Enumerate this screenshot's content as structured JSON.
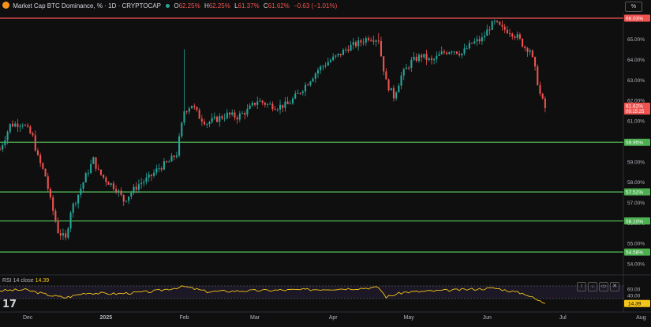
{
  "header": {
    "title": "Market Cap BTC Dominance, % · 1D · CRYPTOCAP",
    "o_label": "O",
    "o_value": "62.25%",
    "h_label": "H",
    "h_value": "62.25%",
    "l_label": "L",
    "l_value": "61.37%",
    "c_label": "C",
    "c_value": "61.62%",
    "change": "−0.63 (−1.01%)",
    "scale_button": "%"
  },
  "colors": {
    "up": "#26a69a",
    "down": "#ef5350",
    "support": "#4caf50",
    "resistance": "#ef5350",
    "rsi": "#f5c518",
    "background": "#0f0f0f"
  },
  "chart_data": {
    "type": "candlestick",
    "title": "Market Cap BTC Dominance, %",
    "ylim": [
      53.5,
      66.3
    ],
    "y_ticks": [
      "65.00%",
      "64.00%",
      "63.00%",
      "62.00%",
      "61.00%",
      "60.00%",
      "59.00%",
      "58.00%",
      "57.00%",
      "56.00%",
      "55.00%",
      "54.00%"
    ],
    "x_ticks": [
      "Dec",
      "2025",
      "Feb",
      "Mar",
      "Apr",
      "May",
      "Jun",
      "Jul",
      "Aug"
    ],
    "close_path": [
      {
        "day": 0,
        "v": 59.6
      },
      {
        "day": 4,
        "v": 60.8
      },
      {
        "day": 9,
        "v": 60.9
      },
      {
        "day": 13,
        "v": 60.2
      },
      {
        "day": 15,
        "v": 59.2
      },
      {
        "day": 18,
        "v": 58.3
      },
      {
        "day": 20,
        "v": 57.1
      },
      {
        "day": 23,
        "v": 55.6
      },
      {
        "day": 26,
        "v": 55.2
      },
      {
        "day": 28,
        "v": 56.6
      },
      {
        "day": 31,
        "v": 57.4
      },
      {
        "day": 34,
        "v": 58.3
      },
      {
        "day": 37,
        "v": 59.1
      },
      {
        "day": 39,
        "v": 58.5
      },
      {
        "day": 42,
        "v": 58.1
      },
      {
        "day": 46,
        "v": 57.7
      },
      {
        "day": 49,
        "v": 57.1
      },
      {
        "day": 52,
        "v": 57.5
      },
      {
        "day": 55,
        "v": 57.9
      },
      {
        "day": 59,
        "v": 58.2
      },
      {
        "day": 63,
        "v": 58.7
      },
      {
        "day": 67,
        "v": 59.0
      },
      {
        "day": 70,
        "v": 59.4
      },
      {
        "day": 73,
        "v": 61.5
      },
      {
        "day": 76,
        "v": 61.8
      },
      {
        "day": 79,
        "v": 61.2
      },
      {
        "day": 82,
        "v": 60.9
      },
      {
        "day": 86,
        "v": 61.1
      },
      {
        "day": 90,
        "v": 61.3
      },
      {
        "day": 94,
        "v": 61.2
      },
      {
        "day": 98,
        "v": 61.5
      },
      {
        "day": 102,
        "v": 62.0
      },
      {
        "day": 106,
        "v": 61.8
      },
      {
        "day": 110,
        "v": 61.7
      },
      {
        "day": 114,
        "v": 61.8
      },
      {
        "day": 118,
        "v": 62.3
      },
      {
        "day": 122,
        "v": 62.9
      },
      {
        "day": 126,
        "v": 63.5
      },
      {
        "day": 130,
        "v": 63.9
      },
      {
        "day": 134,
        "v": 64.2
      },
      {
        "day": 138,
        "v": 64.6
      },
      {
        "day": 142,
        "v": 64.8
      },
      {
        "day": 146,
        "v": 65.1
      },
      {
        "day": 150,
        "v": 65.0
      },
      {
        "day": 151,
        "v": 64.2
      },
      {
        "day": 153,
        "v": 62.9
      },
      {
        "day": 156,
        "v": 62.2
      },
      {
        "day": 159,
        "v": 63.2
      },
      {
        "day": 163,
        "v": 63.9
      },
      {
        "day": 167,
        "v": 64.2
      },
      {
        "day": 171,
        "v": 63.9
      },
      {
        "day": 175,
        "v": 64.3
      },
      {
        "day": 179,
        "v": 64.5
      },
      {
        "day": 183,
        "v": 64.3
      },
      {
        "day": 187,
        "v": 64.8
      },
      {
        "day": 191,
        "v": 65.0
      },
      {
        "day": 194,
        "v": 65.6
      },
      {
        "day": 196,
        "v": 65.8
      },
      {
        "day": 199,
        "v": 65.5
      },
      {
        "day": 202,
        "v": 65.4
      },
      {
        "day": 205,
        "v": 65.1
      },
      {
        "day": 208,
        "v": 64.6
      },
      {
        "day": 210,
        "v": 64.5
      },
      {
        "day": 212,
        "v": 63.5
      },
      {
        "day": 214,
        "v": 62.3
      },
      {
        "day": 216,
        "v": 61.6
      }
    ],
    "wicks": [
      {
        "day": 73,
        "high": 64.5
      },
      {
        "day": 150,
        "high": 65.3
      }
    ],
    "levels": [
      {
        "value": 66.03,
        "label": "66.03%",
        "kind": "resistance"
      },
      {
        "value": 59.95,
        "label": "59.95%",
        "kind": "support"
      },
      {
        "value": 57.52,
        "label": "57.52%",
        "kind": "support"
      },
      {
        "value": 56.1,
        "label": "56.10%",
        "kind": "support"
      },
      {
        "value": 54.58,
        "label": "54.58%",
        "kind": "support"
      }
    ],
    "last_price": {
      "value": 61.62,
      "label": "61.62%",
      "countdown": "09:15:25"
    }
  },
  "rsi": {
    "title": "RSI 14 close",
    "value_label": "14.39",
    "ylim": [
      0,
      100
    ],
    "ticks": [
      "60.00",
      "40.00"
    ],
    "last_value": 14.39,
    "path": [
      {
        "day": 0,
        "v": 55
      },
      {
        "day": 10,
        "v": 58
      },
      {
        "day": 20,
        "v": 40
      },
      {
        "day": 26,
        "v": 33
      },
      {
        "day": 34,
        "v": 48
      },
      {
        "day": 46,
        "v": 45
      },
      {
        "day": 60,
        "v": 52
      },
      {
        "day": 73,
        "v": 68
      },
      {
        "day": 82,
        "v": 52
      },
      {
        "day": 100,
        "v": 55
      },
      {
        "day": 120,
        "v": 58
      },
      {
        "day": 140,
        "v": 62
      },
      {
        "day": 150,
        "v": 65
      },
      {
        "day": 153,
        "v": 35
      },
      {
        "day": 160,
        "v": 50
      },
      {
        "day": 175,
        "v": 55
      },
      {
        "day": 196,
        "v": 63
      },
      {
        "day": 208,
        "v": 45
      },
      {
        "day": 213,
        "v": 25
      },
      {
        "day": 216,
        "v": 14.39
      }
    ],
    "buttons": [
      "↑",
      "↓",
      "▭",
      "✕"
    ]
  },
  "logo_text": "17"
}
